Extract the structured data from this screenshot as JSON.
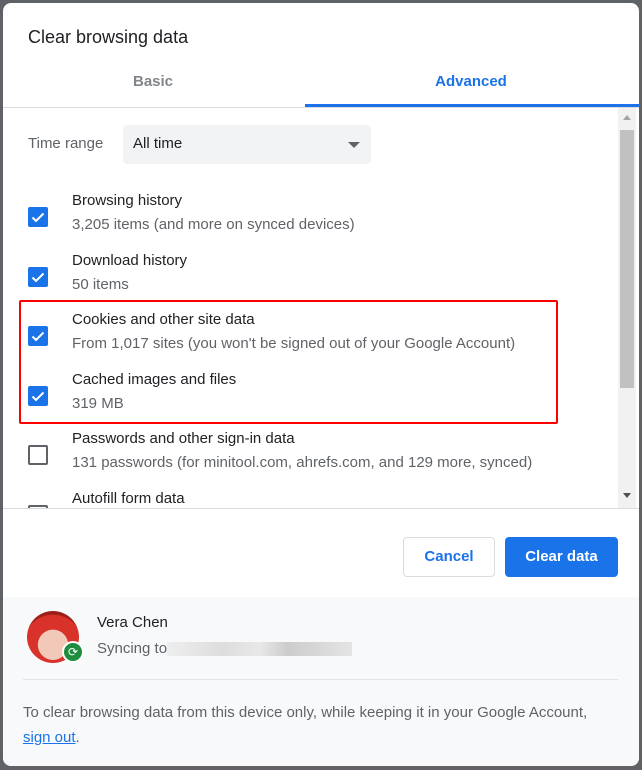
{
  "dialog": {
    "title": "Clear browsing data"
  },
  "tabs": [
    {
      "label": "Basic",
      "active": false
    },
    {
      "label": "Advanced",
      "active": true
    }
  ],
  "time_range": {
    "label": "Time range",
    "value": "All time"
  },
  "items": [
    {
      "title": "Browsing history",
      "subtitle": "3,205 items (and more on synced devices)",
      "checked": true
    },
    {
      "title": "Download history",
      "subtitle": "50 items",
      "checked": true
    },
    {
      "title": "Cookies and other site data",
      "subtitle": "From 1,017 sites (you won't be signed out of your Google Account)",
      "checked": true
    },
    {
      "title": "Cached images and files",
      "subtitle": "319 MB",
      "checked": true
    },
    {
      "title": "Passwords and other sign-in data",
      "subtitle": "131 passwords (for minitool.com, ahrefs.com, and 129 more, synced)",
      "checked": false
    },
    {
      "title": "Autofill form data",
      "subtitle": "",
      "checked": false
    }
  ],
  "buttons": {
    "cancel": "Cancel",
    "clear": "Clear data"
  },
  "account": {
    "name": "Vera Chen",
    "sync_prefix": "Syncing to"
  },
  "footer": {
    "note_before": "To clear browsing data from this device only, while keeping it in your Google Account, ",
    "link": "sign out",
    "note_after": "."
  },
  "colors": {
    "accent": "#1a73e8",
    "highlight": "#ff0000",
    "sync_badge": "#1e8e3e"
  }
}
